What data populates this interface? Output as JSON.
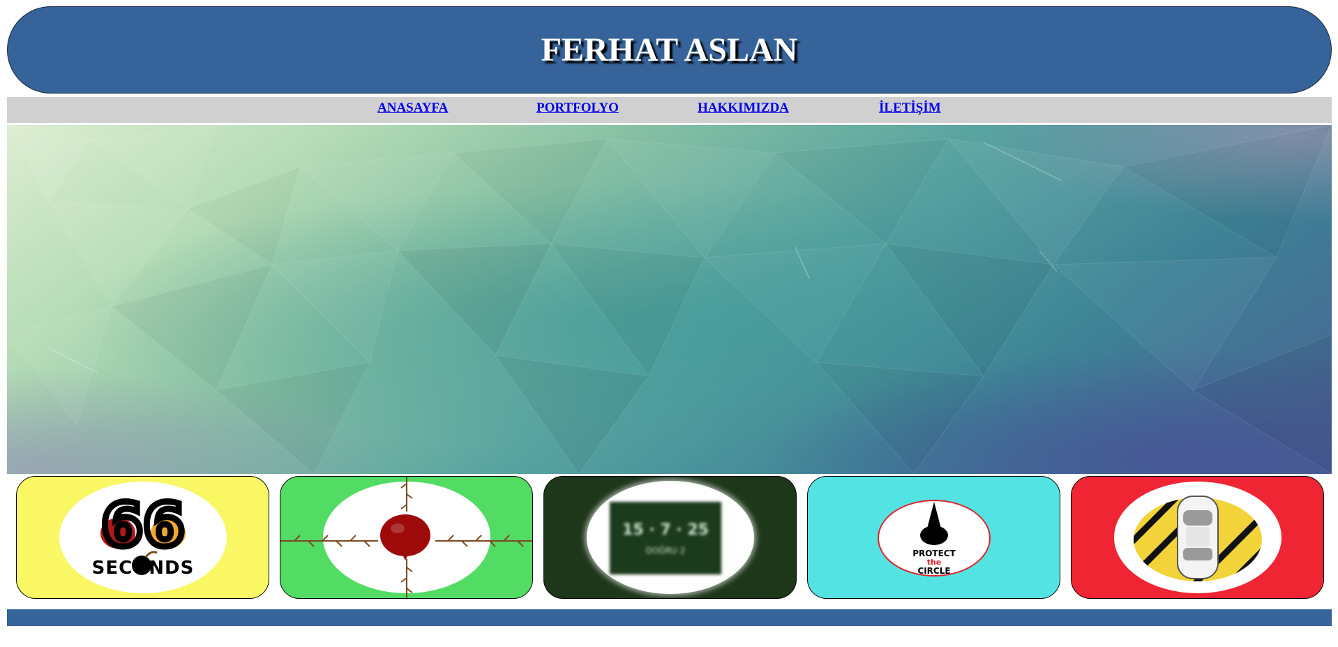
{
  "header": {
    "title": "FERHAT ASLAN",
    "bg_color": "#36639a"
  },
  "nav": {
    "items": [
      {
        "label": "ANASAYFA"
      },
      {
        "label": "PORTFOLYO"
      },
      {
        "label": "HAKKIMIZDA"
      },
      {
        "label": "İLETİŞİM"
      }
    ],
    "bg_color": "#d0d0d0",
    "link_color": "#0000ee"
  },
  "hero": {
    "description_icon": "low-poly-banner-image"
  },
  "portfolio": {
    "cards": [
      {
        "logo_lines": [
          "66",
          "SECONDS"
        ],
        "bg_color": "#f9f764",
        "icon": "bomb-glasses-logo"
      },
      {
        "bg_color": "#52dc64",
        "icon": "red-balloon-thorns-logo"
      },
      {
        "logo_lines": [
          "15 · 7 · 25",
          "DOĞRU 2"
        ],
        "bg_color": "#1e361a",
        "icon": "blurred-score-board-logo"
      },
      {
        "logo_lines": [
          "PROTECT",
          "the",
          "CIRCLE"
        ],
        "bg_color": "#54e3e3",
        "icon": "protect-the-circle-logo"
      },
      {
        "bg_color": "#f02533",
        "icon": "car-on-road-logo"
      }
    ]
  },
  "footer": {
    "bg_color": "#36639a"
  }
}
